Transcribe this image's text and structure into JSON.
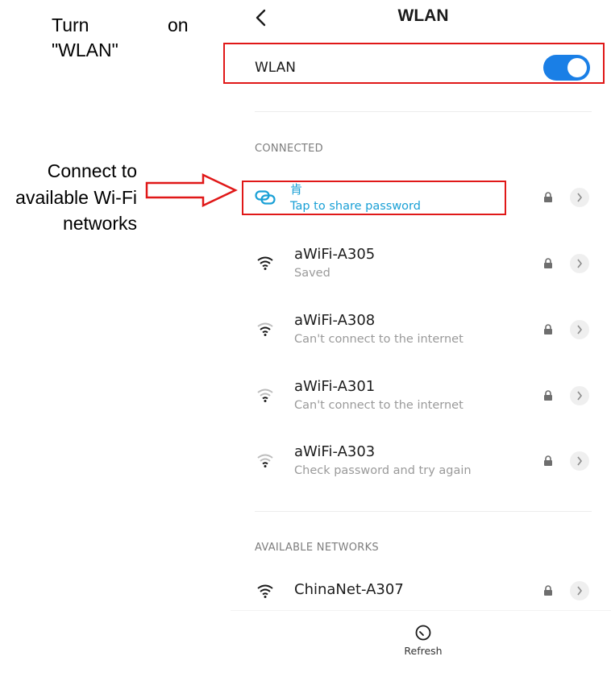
{
  "annotations": {
    "turn_on_line1_a": "Turn",
    "turn_on_line1_b": "on",
    "turn_on_line2": "\"WLAN\"",
    "connect_line1": "Connect to",
    "connect_line2": "available Wi-Fi",
    "connect_line3": "networks"
  },
  "header": {
    "back_icon": "chevron-left-icon",
    "title": "WLAN"
  },
  "wlan_toggle": {
    "label": "WLAN",
    "on": true,
    "accent": "#1a7fe6"
  },
  "connected_section": {
    "heading": "CONNECTED",
    "network": {
      "name": "肯",
      "subtitle": "Tap to share password",
      "icon": "link-icon",
      "color": "#1aa0d6"
    }
  },
  "saved_networks": [
    {
      "name": "aWiFi-A305",
      "status": "Saved"
    },
    {
      "name": "aWiFi-A308",
      "status": "Can't connect to the internet"
    },
    {
      "name": "aWiFi-A301",
      "status": "Can't connect to the internet"
    },
    {
      "name": "aWiFi-A303",
      "status": "Check password and try again"
    }
  ],
  "available_section": {
    "heading": "AVAILABLE NETWORKS",
    "networks": [
      {
        "name": "ChinaNet-A307"
      }
    ]
  },
  "footer": {
    "refresh_label": "Refresh",
    "refresh_icon": "refresh-icon"
  },
  "colors": {
    "highlight_box": "#e01818",
    "link": "#1aa0d6"
  }
}
